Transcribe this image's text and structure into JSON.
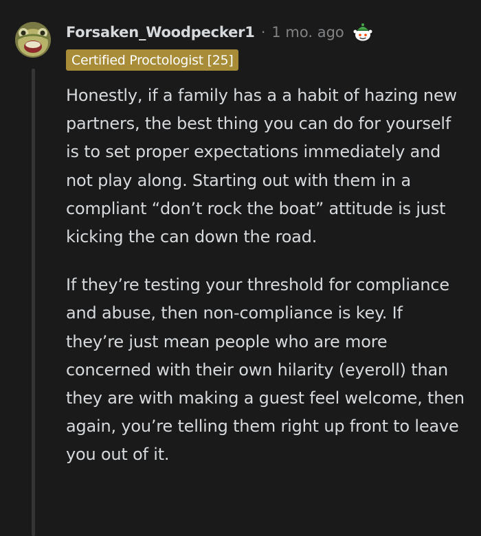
{
  "comment": {
    "username": "Forsaken_Woodpecker1",
    "separator": "·",
    "timestamp": "1 mo. ago",
    "flair": "Certified Proctologist [25]",
    "paragraphs": [
      "Honestly, if a family has a a habit of hazing new partners, the best thing you can do for yourself is to set proper expectations immediately and not play along. Starting out with them in a compliant “don’t rock the boat” attitude is just kicking the can down the road.",
      "If they’re testing your threshold for compliance and abuse, then non-compliance is key. If they’re just mean people who are more concerned with their own hilarity (eyeroll) than they are with making a guest feel welcome, then again, you’re telling them right up front to leave you out of it."
    ]
  },
  "colors": {
    "background": "#1a1a1b",
    "text": "#d7dadc",
    "meta": "#818384",
    "flair_bg": "#a88c38",
    "thread_line": "#343536"
  },
  "icons": {
    "avatar": "user-avatar-lizard",
    "award": "snoo-award-icon"
  }
}
